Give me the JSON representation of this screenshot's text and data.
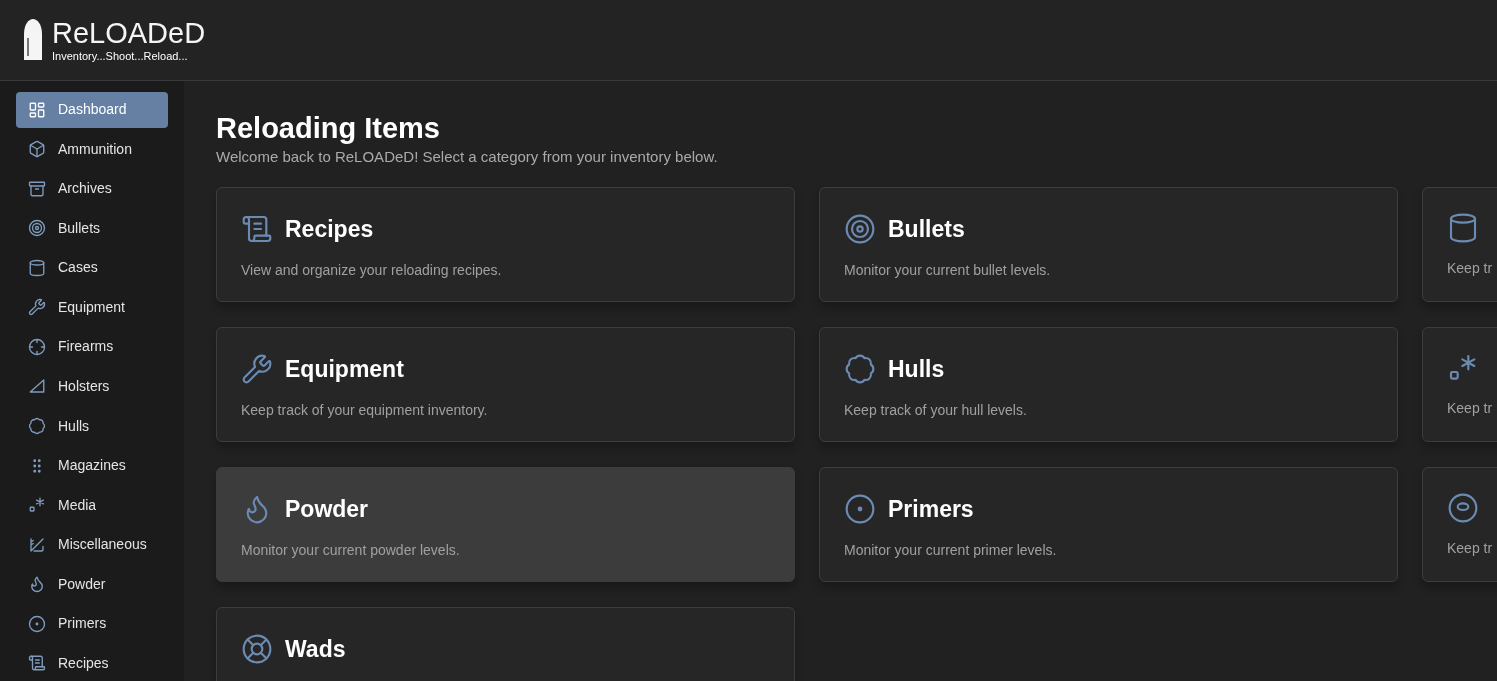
{
  "app": {
    "name": "ReLOADeD",
    "tagline": "Inventory...Shoot...Reload..."
  },
  "sidebar": {
    "items": [
      {
        "label": "Dashboard",
        "selected": true
      },
      {
        "label": "Ammunition",
        "selected": false
      },
      {
        "label": "Archives",
        "selected": false
      },
      {
        "label": "Bullets",
        "selected": false
      },
      {
        "label": "Cases",
        "selected": false
      },
      {
        "label": "Equipment",
        "selected": false
      },
      {
        "label": "Firearms",
        "selected": false
      },
      {
        "label": "Holsters",
        "selected": false
      },
      {
        "label": "Hulls",
        "selected": false
      },
      {
        "label": "Magazines",
        "selected": false
      },
      {
        "label": "Media",
        "selected": false
      },
      {
        "label": "Miscellaneous",
        "selected": false
      },
      {
        "label": "Powder",
        "selected": false
      },
      {
        "label": "Primers",
        "selected": false
      },
      {
        "label": "Recipes",
        "selected": false
      }
    ]
  },
  "page": {
    "title": "Reloading Items",
    "subtitle": "Welcome back to ReLOADeD! Select a category from your inventory below."
  },
  "cards": [
    {
      "title": "Recipes",
      "description": "View and organize your reloading recipes.",
      "highlighted": false
    },
    {
      "title": "Bullets",
      "description": "Monitor your current bullet levels.",
      "highlighted": false
    },
    {
      "description": "Keep tr",
      "highlighted": false
    },
    {
      "title": "Equipment",
      "description": "Keep track of your equipment inventory.",
      "highlighted": false
    },
    {
      "title": "Hulls",
      "description": "Keep track of your hull levels.",
      "highlighted": false
    },
    {
      "description": "Keep tr",
      "highlighted": false
    },
    {
      "title": "Powder",
      "description": "Monitor your current powder levels.",
      "highlighted": true
    },
    {
      "title": "Primers",
      "description": "Monitor your current primer levels.",
      "highlighted": false
    },
    {
      "description": "Keep tr",
      "highlighted": false
    },
    {
      "title": "Wads",
      "highlighted": false
    }
  ]
}
